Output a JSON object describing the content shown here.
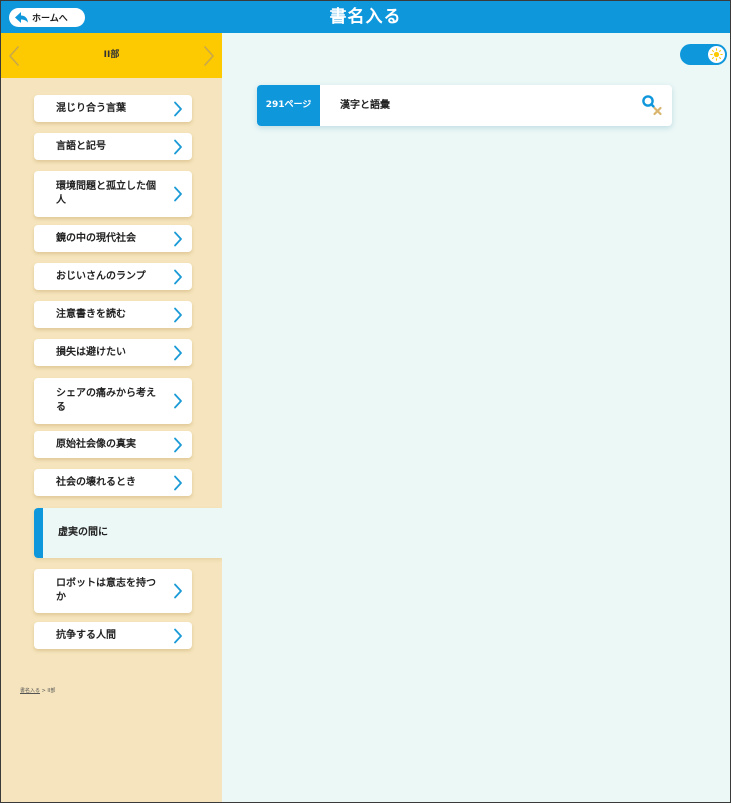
{
  "header": {
    "home_label": "ホームへ",
    "title": "書名入る"
  },
  "sidebar": {
    "part_label": "II部",
    "items": [
      {
        "label": "混じり合う言葉"
      },
      {
        "label": "言語と記号"
      },
      {
        "label": "環境問題と孤立した個人"
      },
      {
        "label": "鏡の中の現代社会"
      },
      {
        "label": "おじいさんのランプ"
      },
      {
        "label": "注意書きを読む"
      },
      {
        "label": "損失は避けたい"
      },
      {
        "label": "シェアの痛みから考える"
      },
      {
        "label": "原始社会像の真実"
      },
      {
        "label": "社会の壊れるとき"
      },
      {
        "label": "虚実の間に",
        "active": true
      },
      {
        "label": "ロボットは意志を持つか"
      },
      {
        "label": "抗争する人間"
      }
    ],
    "breadcrumb": {
      "link": "書名入る",
      "separator": " > ",
      "current": "II部"
    }
  },
  "main": {
    "toggle_state": "on",
    "results": [
      {
        "page": "291ページ",
        "title": "漢字と語彙"
      }
    ]
  },
  "colors": {
    "header_blue": "#0f97dc",
    "part_bar_yellow": "#fdc901",
    "sidebar_bg": "#f5e4bd",
    "main_bg": "#ecf8f6",
    "chevron_blue": "#1a9ad6",
    "icon_search_blue": "#0f97dc",
    "icon_close_tan": "#d9b56d"
  },
  "icons": {
    "home": "arrow-back-icon",
    "prev": "chevron-left-icon",
    "next": "chevron-right-icon",
    "item": "chevron-right-icon",
    "toggle": "sun-icon",
    "result": "search-close-icon"
  }
}
